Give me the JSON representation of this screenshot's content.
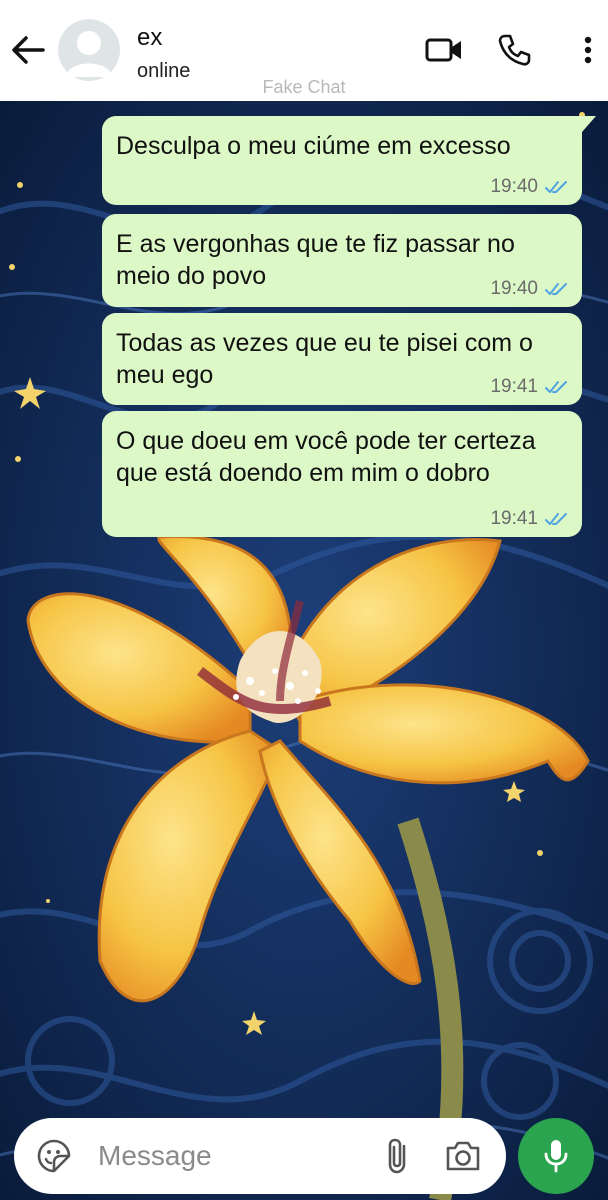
{
  "header": {
    "contact_name": "ex",
    "status": "online",
    "watermark": "Fake Chat",
    "icons": [
      "back-arrow-icon",
      "avatar-placeholder-icon",
      "video-call-icon",
      "phone-call-icon",
      "more-options-icon"
    ]
  },
  "messages": [
    {
      "text": "Desculpa o meu ciúme em excesso",
      "time": "19:40",
      "status": "read"
    },
    {
      "text": "E as vergonhas que te fiz passar no meio do povo",
      "time": "19:40",
      "status": "read"
    },
    {
      "text": "Todas as vezes que eu te pisei com o meu ego",
      "time": "19:41",
      "status": "read"
    },
    {
      "text": "O que doeu em você pode ter certeza que está doendo em mim o dobro",
      "time": "19:41",
      "status": "read"
    }
  ],
  "composer": {
    "placeholder": "Message",
    "value": "",
    "icons": [
      "emoji-sticker-icon",
      "paperclip-icon",
      "camera-icon",
      "microphone-icon"
    ]
  },
  "colors": {
    "bubble": "#dcf8c6",
    "read_ticks": "#4fa3e3",
    "mic_button": "#2ba44f",
    "wallpaper_sky": "#0c2347",
    "flower": "#f6c445"
  }
}
